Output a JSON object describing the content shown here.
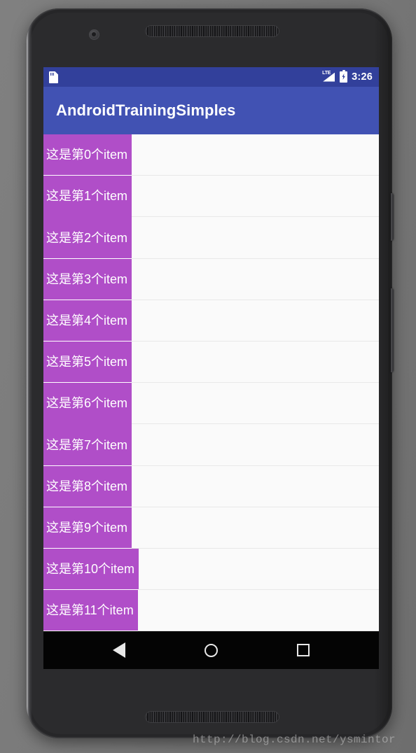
{
  "device": {
    "front_camera": "front-camera",
    "earpiece": "earpiece-speaker",
    "bottom_speaker": "bottom-speaker",
    "power_button": "power-button",
    "volume_button": "volume-button"
  },
  "status_bar": {
    "sd_icon": "sd-card-icon",
    "signal_icon": "lte-signal-icon",
    "signal_label": "LTE",
    "battery_icon": "battery-charging-icon",
    "time": "3:26",
    "background_color": "#32409b"
  },
  "app_bar": {
    "title": "AndroidTrainingSimples",
    "background_color": "#4152b3",
    "text_color": "#ffffff"
  },
  "list": {
    "item_background_color": "#b04ec8",
    "item_text_color": "#ffffff",
    "screen_background_color": "#fafafa",
    "divider_color": "#e8e8e8",
    "items": [
      {
        "label": "这是第0个item"
      },
      {
        "label": "这是第1个item"
      },
      {
        "label": "这是第2个item"
      },
      {
        "label": "这是第3个item"
      },
      {
        "label": "这是第4个item"
      },
      {
        "label": "这是第5个item"
      },
      {
        "label": "这是第6个item"
      },
      {
        "label": "这是第7个item"
      },
      {
        "label": "这是第8个item"
      },
      {
        "label": "这是第9个item"
      },
      {
        "label": "这是第10个item"
      },
      {
        "label": "这是第11个item"
      }
    ]
  },
  "nav_bar": {
    "back": "back-icon",
    "home": "home-icon",
    "recents": "recents-icon",
    "background_color": "#040404"
  },
  "watermark": {
    "text": "http://blog.csdn.net/ysmintor"
  }
}
